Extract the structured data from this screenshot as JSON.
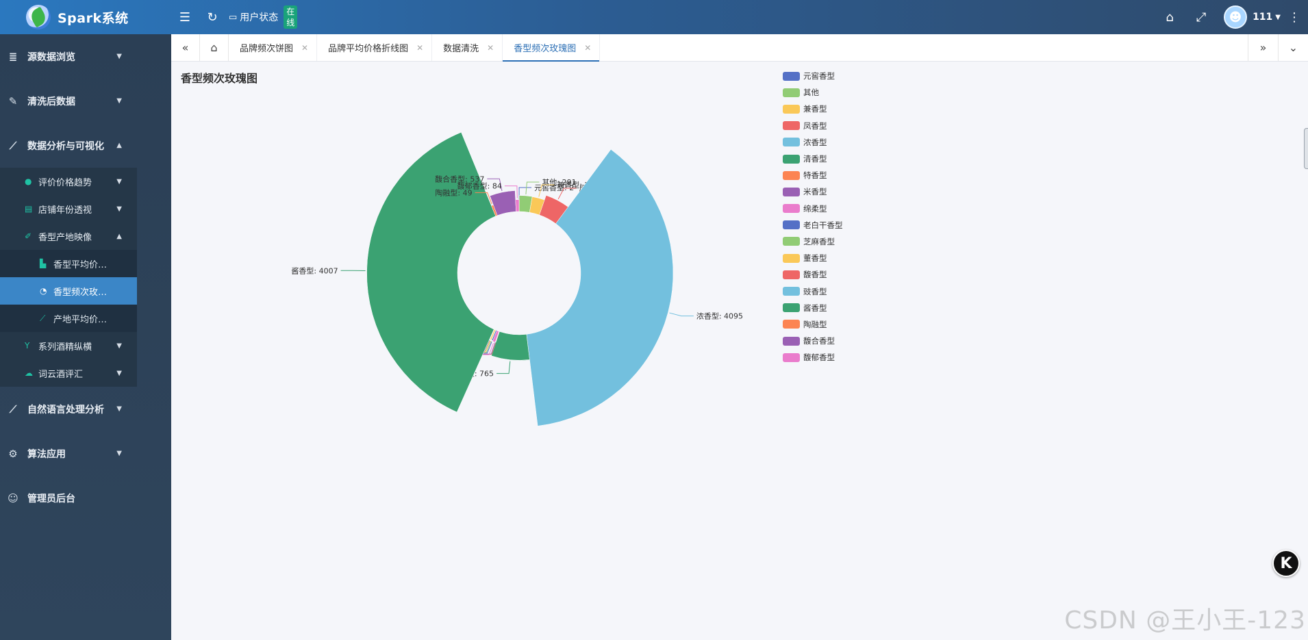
{
  "app": {
    "title": "Spark系统"
  },
  "header": {
    "user_status_label": "用户状态",
    "online_badge": "在线",
    "username": "111"
  },
  "sidebar": {
    "items": [
      {
        "label": "源数据浏览",
        "icon": "database-icon"
      },
      {
        "label": "清洗后数据",
        "icon": "broom-icon"
      },
      {
        "label": "数据分析与可视化",
        "icon": "line-chart-icon",
        "expanded": true,
        "children": [
          {
            "label": "评价价格趋势",
            "icon": "comment-icon"
          },
          {
            "label": "店铺年份透视",
            "icon": "store-icon"
          },
          {
            "label": "香型产地映像",
            "icon": "bottle-icon",
            "expanded": true,
            "children": [
              {
                "label": "香型平均价…",
                "icon": "bar-chart-icon"
              },
              {
                "label": "香型频次玫…",
                "icon": "pie-chart-icon",
                "active": true
              },
              {
                "label": "产地平均价…",
                "icon": "line-chart-icon"
              }
            ]
          },
          {
            "label": "系列酒精纵横",
            "icon": "cocktail-icon"
          },
          {
            "label": "词云酒评汇",
            "icon": "cloud-icon"
          }
        ]
      },
      {
        "label": "自然语言处理分析",
        "icon": "line-chart-icon"
      },
      {
        "label": "算法应用",
        "icon": "robot-icon"
      },
      {
        "label": "管理员后台",
        "icon": "user-cog-icon"
      }
    ]
  },
  "tabs": [
    {
      "label": "品牌频次饼图"
    },
    {
      "label": "品牌平均价格折线图"
    },
    {
      "label": "数据清洗"
    },
    {
      "label": "香型频次玫瑰图",
      "active": true
    }
  ],
  "watermark": "CSDN @王小王-123",
  "chart_data": {
    "type": "pie",
    "subtype": "rose",
    "title": "香型频次玫瑰图",
    "legend_position": "right",
    "slices": [
      {
        "name": "元窖香型",
        "value": 2,
        "color": "#5470c6"
      },
      {
        "name": "其他",
        "value": 291,
        "color": "#91cc75"
      },
      {
        "name": "兼香型",
        "value": 282,
        "color": "#fac858"
      },
      {
        "name": "凤香型",
        "value": 522,
        "color": "#ee6666"
      },
      {
        "name": "浓香型",
        "value": 4095,
        "color": "#73c0de"
      },
      {
        "name": "清香型",
        "value": 765,
        "color": "#3ba272"
      },
      {
        "name": "特香型",
        "value": 10,
        "color": "#fc8452"
      },
      {
        "name": "米香型",
        "value": 5,
        "color": "#9a60b4"
      },
      {
        "name": "绵柔型",
        "value": 65,
        "color": "#ea7ccc"
      },
      {
        "name": "老白干香型",
        "value": 29,
        "color": "#5470c6"
      },
      {
        "name": "芝麻香型",
        "value": 13,
        "color": "#91cc75"
      },
      {
        "name": "董香型",
        "value": 30,
        "color": "#fac858"
      },
      {
        "name": "馥香型",
        "value": 7,
        "color": "#ee6666"
      },
      {
        "name": "豉香型",
        "value": 7,
        "color": "#73c0de"
      },
      {
        "name": "酱香型",
        "value": 4007,
        "color": "#3ba272"
      },
      {
        "name": "陶融型",
        "value": 49,
        "color": "#fc8452"
      },
      {
        "name": "馥合香型",
        "value": 537,
        "color": "#9a60b4"
      },
      {
        "name": "馥郁香型",
        "value": 84,
        "color": "#ea7ccc"
      }
    ]
  }
}
